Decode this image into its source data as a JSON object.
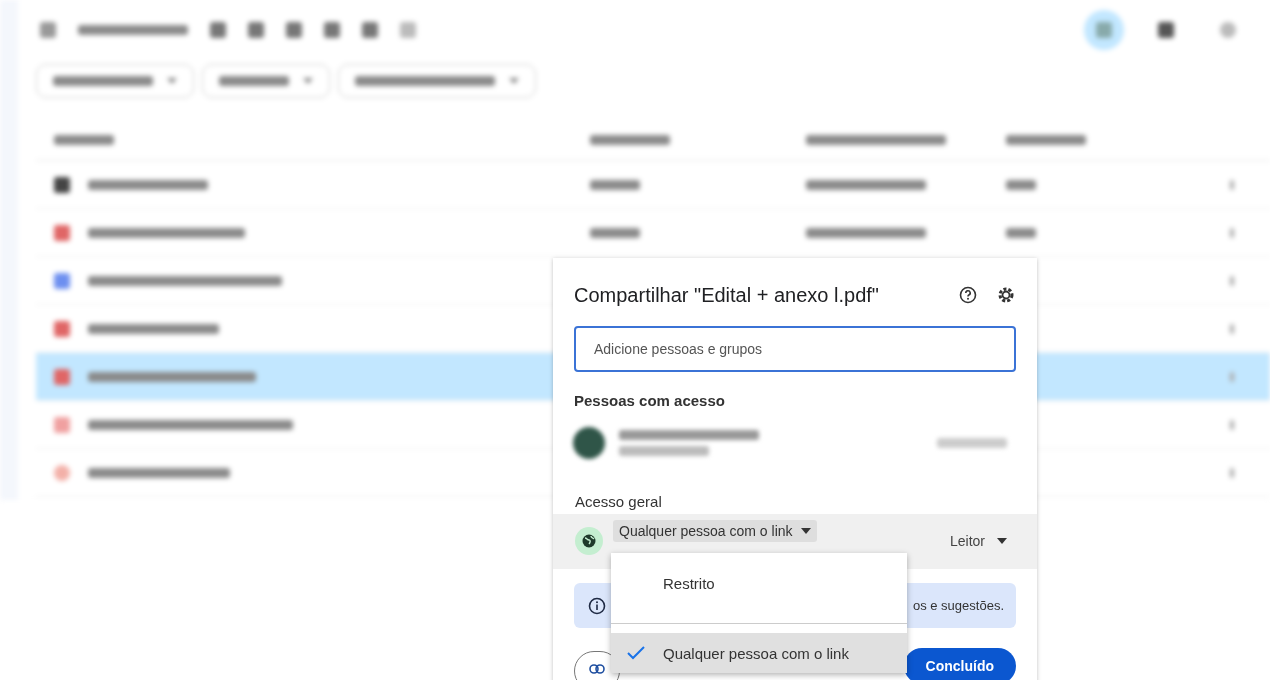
{
  "drive": {
    "files": [
      {
        "kind": "folder",
        "selected": false
      },
      {
        "kind": "pdf",
        "selected": false
      },
      {
        "kind": "doc",
        "selected": false
      },
      {
        "kind": "pdf",
        "selected": false
      },
      {
        "kind": "pdf",
        "selected": true
      },
      {
        "kind": "image",
        "selected": false
      },
      {
        "kind": "photo",
        "selected": false
      }
    ]
  },
  "dialog": {
    "title": "Compartilhar \"Edital + anexo l.pdf\"",
    "search": {
      "placeholder": "Adicione pessoas e grupos"
    },
    "people_heading": "Pessoas com acesso",
    "general_heading": "Acesso geral",
    "access_value": "Qualquer pessoa com o link",
    "role": "Leitor",
    "info_text": "os e sugestões.",
    "done_button": "Concluído",
    "access_menu": [
      {
        "label": "Restrito",
        "selected": false
      },
      {
        "label": "Qualquer pessoa com o link",
        "selected": true
      }
    ]
  }
}
